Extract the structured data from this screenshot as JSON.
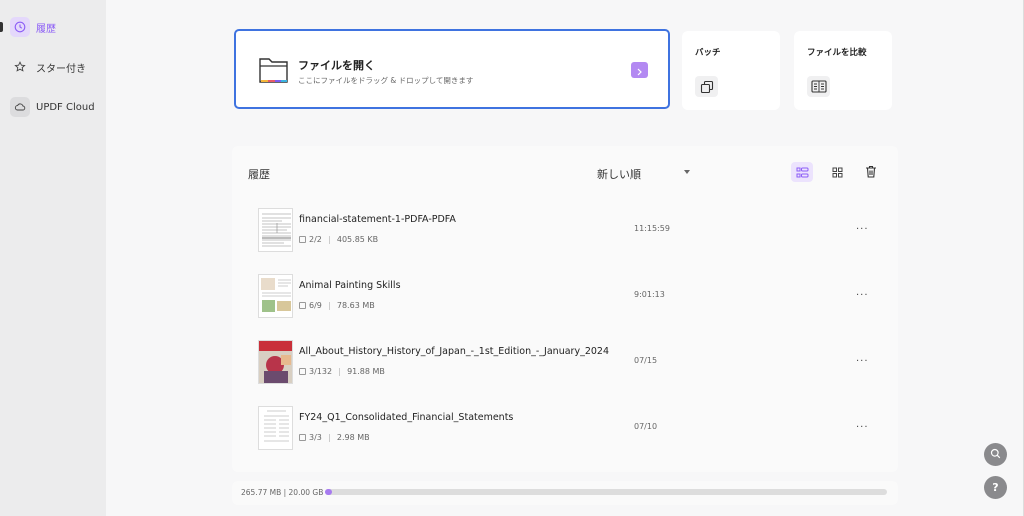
{
  "sidebar": {
    "items": [
      {
        "label": "履歴",
        "icon": "clock-icon",
        "active": true
      },
      {
        "label": "スター付き",
        "icon": "star-icon",
        "active": false
      },
      {
        "label": "UPDF Cloud",
        "icon": "cloud-icon",
        "active": false
      }
    ]
  },
  "open_card": {
    "title": "ファイルを開く",
    "subtitle": "ここにファイルをドラッグ & ドロップして開きます"
  },
  "batch_card": {
    "title": "バッチ"
  },
  "compare_card": {
    "title": "ファイルを比較"
  },
  "history": {
    "title": "履歴",
    "sort_label": "新しい順",
    "files": [
      {
        "name": "financial-statement-1-PDFA-PDFA",
        "pages": "2/2",
        "size": "405.85 KB",
        "time": "11:15:59"
      },
      {
        "name": "Animal Painting Skills",
        "pages": "6/9",
        "size": "78.63 MB",
        "time": "9:01:13"
      },
      {
        "name": "All_About_History_History_of_Japan_-_1st_Edition_-_January_2024",
        "pages": "3/132",
        "size": "91.88 MB",
        "time": "07/15"
      },
      {
        "name": "FY24_Q1_Consolidated_Financial_Statements",
        "pages": "3/3",
        "size": "2.98 MB",
        "time": "07/10"
      }
    ]
  },
  "storage": {
    "text": "265.77 MB | 20.00 GB",
    "used_fraction": 0.013
  },
  "colors": {
    "accent": "#8b5cf6",
    "open_border": "#3f73e0"
  },
  "help_label": "?"
}
